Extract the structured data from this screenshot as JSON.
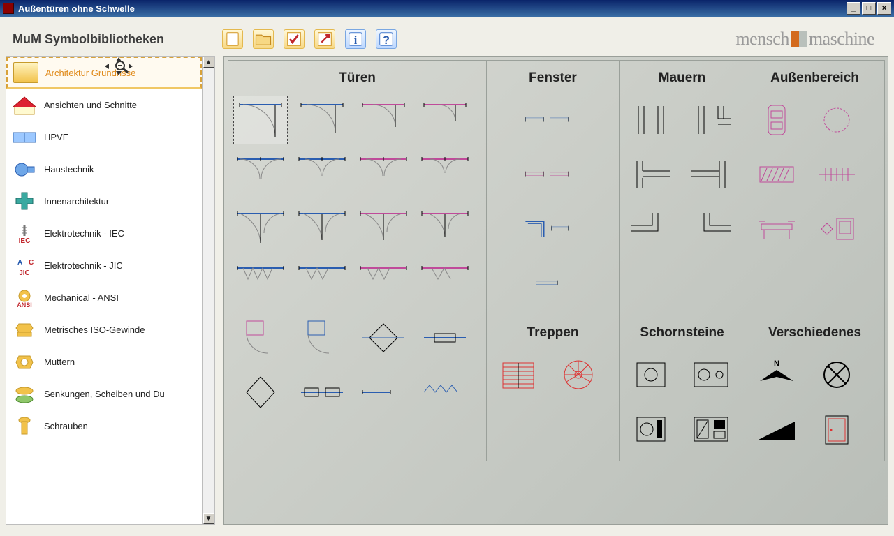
{
  "window": {
    "title": "Außentüren ohne Schwelle",
    "brand_left": "mensch",
    "brand_right": "maschine"
  },
  "header": {
    "lib_title": "MuM Symbolbibliotheken"
  },
  "toolbar_buttons": [
    {
      "name": "new-icon"
    },
    {
      "name": "open-icon"
    },
    {
      "name": "check-icon"
    },
    {
      "name": "tool-icon"
    },
    {
      "name": "info-icon"
    },
    {
      "name": "help-icon"
    }
  ],
  "sidebar": {
    "items": [
      {
        "label": "Architektur Grundrisse",
        "icon": "floorplan-yellow",
        "selected": true
      },
      {
        "label": "Ansichten und Schnitte",
        "icon": "house-red"
      },
      {
        "label": "HPVE",
        "icon": "pipe-blue"
      },
      {
        "label": "Haustechnik",
        "icon": "radiator-blue"
      },
      {
        "label": "Innenarchitektur",
        "icon": "cross-teal"
      },
      {
        "label": "Elektrotechnik - IEC",
        "icon": "iec-red"
      },
      {
        "label": "Elektrotechnik - JIC",
        "icon": "jic-blue"
      },
      {
        "label": "Mechanical - ANSI",
        "icon": "ansi-gear"
      },
      {
        "label": "Metrisches ISO-Gewinde",
        "icon": "iso-yellow"
      },
      {
        "label": "Muttern",
        "icon": "nut-yellow"
      },
      {
        "label": "Senkungen, Scheiben und Du",
        "icon": "washer-yellow"
      },
      {
        "label": "Schrauben",
        "icon": "bolt-yellow"
      }
    ]
  },
  "panel": {
    "sections": [
      {
        "title": "Türen",
        "cols": 4,
        "span": "col1",
        "rows": 6,
        "symbols": [
          "door-arc-1",
          "door-arc-2",
          "door-arc-3",
          "door-arc-4",
          "door-double-arc-1",
          "door-double-arc-2",
          "door-double-arc-3",
          "door-double-arc-4",
          "door-wide-arc-1",
          "door-wide-arc-2",
          "door-wide-arc-3",
          "door-wide-arc-4",
          "door-fold-1",
          "door-fold-2",
          "door-fold-3",
          "door-fold-4",
          "door-swing-1",
          "door-swing-2",
          "door-butterfly",
          "door-slide",
          "door-biparting",
          "door-wavy",
          "door-sliding-short",
          "door-zigzag"
        ]
      },
      {
        "title": "Fenster",
        "cols": 1,
        "span": "col2",
        "rows": 5,
        "symbols": [
          "window-double-1",
          "window-double-2",
          "window-corner",
          "window-single",
          "window-short"
        ]
      },
      {
        "title": "Mauern",
        "cols": 2,
        "span": "col3",
        "rows": 3,
        "symbols": [
          "wall-gap-a",
          "wall-tee-a",
          "wall-tee-b",
          "wall-tee-c",
          "wall-corner-a",
          "wall-corner-b"
        ]
      },
      {
        "title": "Außenbereich",
        "cols": 2,
        "span": "col4",
        "rows": 3,
        "symbols": [
          "car-top",
          "bush",
          "hatch-rect",
          "fence-post",
          "bench",
          "tv-lamp"
        ]
      },
      {
        "title": "Treppen",
        "cols": 2,
        "span": "col2b",
        "symbols": [
          "stair-straight",
          "stair-spiral"
        ]
      },
      {
        "title": "Schornsteine",
        "cols": 2,
        "span": "col3b",
        "symbols": [
          "flue-1",
          "flue-2",
          "flue-3",
          "flue-4"
        ]
      },
      {
        "title": "Verschiedenes",
        "cols": 2,
        "span": "col4b",
        "symbols": [
          "north-arrow",
          "circle-x",
          "wedge",
          "door-elevation"
        ]
      }
    ]
  }
}
